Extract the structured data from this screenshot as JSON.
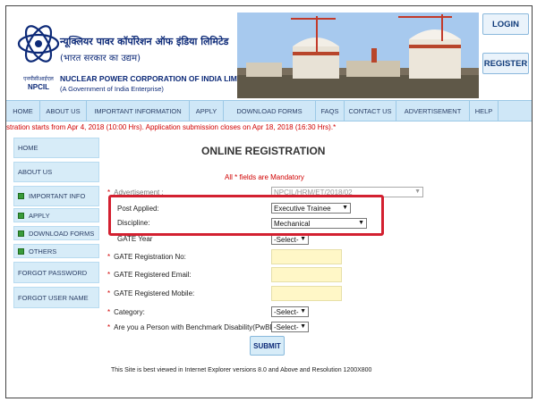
{
  "header": {
    "logo_text": "NPCIL",
    "logo_hindi": "एनपीसीआईएल",
    "org_hindi": "न्यूक्लियर पावर कॉर्पोरेशन ऑफ इंडिया लिमिटेड",
    "org_hindi_sub": "(भारत सरकार का उद्यम)",
    "org_en": "NUCLEAR POWER CORPORATION OF INDIA LIMITED",
    "org_en_sub": "(A Government of India Enterprise)",
    "login_label": "LOGIN",
    "register_label": "REGISTER"
  },
  "nav": {
    "items": [
      "HOME",
      "ABOUT US",
      "IMPORTANT INFORMATION",
      "APPLY",
      "DOWNLOAD FORMS",
      "FAQS",
      "CONTACT US",
      "ADVERTISEMENT",
      "HELP"
    ]
  },
  "notice": "stration starts from Apr 4, 2018 (10:00 Hrs). Application submission closes on Apr 18, 2018 (16:30 Hrs).*",
  "sidebar": {
    "items": [
      "HOME",
      "ABOUT US",
      "IMPORTANT INFO",
      "APPLY",
      "DOWNLOAD FORMS",
      "OTHERS",
      "FORGOT PASSWORD",
      "FORGOT USER NAME"
    ]
  },
  "form": {
    "title": "ONLINE REGISTRATION",
    "mandatory_note": "All * fields are Mandatory",
    "advertisement_label": "Advertisement :",
    "advertisement_value": "NPCIL/HRM/ET/2018/02",
    "post_label": "Post Applied:",
    "post_value": "Executive Trainee",
    "discipline_label": "Discipline:",
    "discipline_value": "Mechanical",
    "gate_year_label": "GATE Year",
    "gate_year_value": "-Select-",
    "gate_reg_no_label": "GATE Registration No:",
    "gate_email_label": "GATE Registered Email:",
    "gate_mobile_label": "GATE Registered Mobile:",
    "category_label": "Category:",
    "category_value": "-Select-",
    "pwbd_label": "Are you a Person with Benchmark Disability(PwBD)?",
    "pwbd_value": "-Select-",
    "submit_label": "SUBMIT"
  },
  "footer": "This Site is best viewed in Internet Explorer versions 8.0 and Above and Resolution 1200X800",
  "colors": {
    "brand_blue": "#0d2a78",
    "required_red": "#d00000",
    "highlight_red": "#d32030",
    "nav_bg": "#cfe7f7",
    "input_yellow": "#fff7c7"
  }
}
